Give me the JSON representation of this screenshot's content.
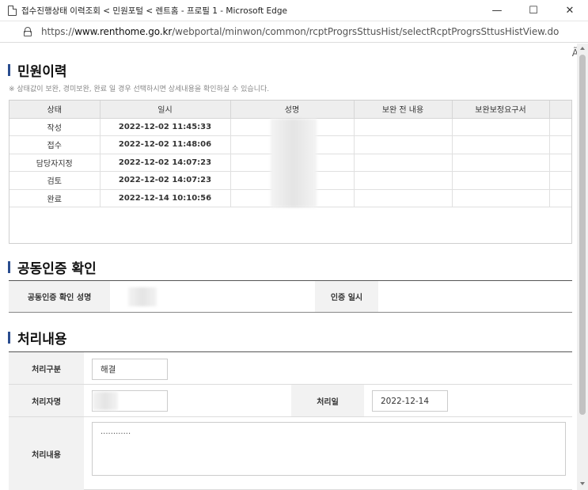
{
  "window": {
    "title": "접수진행상태 이력조회 < 민원포털 < 렌트홈 - 프로필 1 - Microsoft Edge",
    "minimize_glyph": "—",
    "maximize_glyph": "☐",
    "close_glyph": "✕"
  },
  "address": {
    "scheme": "https://",
    "host": "www.renthome.go.kr",
    "path": "/webportal/minwon/common/rcptProgrsSttusHist/selectRcptProgrsSttusHistView.do",
    "reader_icon": "Ã"
  },
  "history": {
    "title": "민원이력",
    "note": "※ 상태값이 보완, 경미보완, 완료 일 경우 선택하시면 상세내용을 확인하실 수 있습니다.",
    "columns": [
      "상태",
      "일시",
      "성명",
      "보완 전 내용",
      "보완보정요구서"
    ],
    "rows": [
      {
        "status": "작성",
        "datetime": "2022-12-02 11:45:33"
      },
      {
        "status": "접수",
        "datetime": "2022-12-02 11:48:06"
      },
      {
        "status": "담당자지정",
        "datetime": "2022-12-02 14:07:23"
      },
      {
        "status": "검토",
        "datetime": "2022-12-02 14:07:23"
      },
      {
        "status": "완료",
        "datetime": "2022-12-14 10:10:56"
      }
    ]
  },
  "cert": {
    "title": "공동인증 확인",
    "name_label": "공동인증 확인 성명",
    "date_label": "인증 일시"
  },
  "process": {
    "title": "처리내용",
    "type_label": "처리구분",
    "type_value": "해결",
    "handler_label": "처리자명",
    "date_label": "처리일",
    "date_value": "2022-12-14",
    "content_label": "처리내용",
    "content_value": "............"
  }
}
